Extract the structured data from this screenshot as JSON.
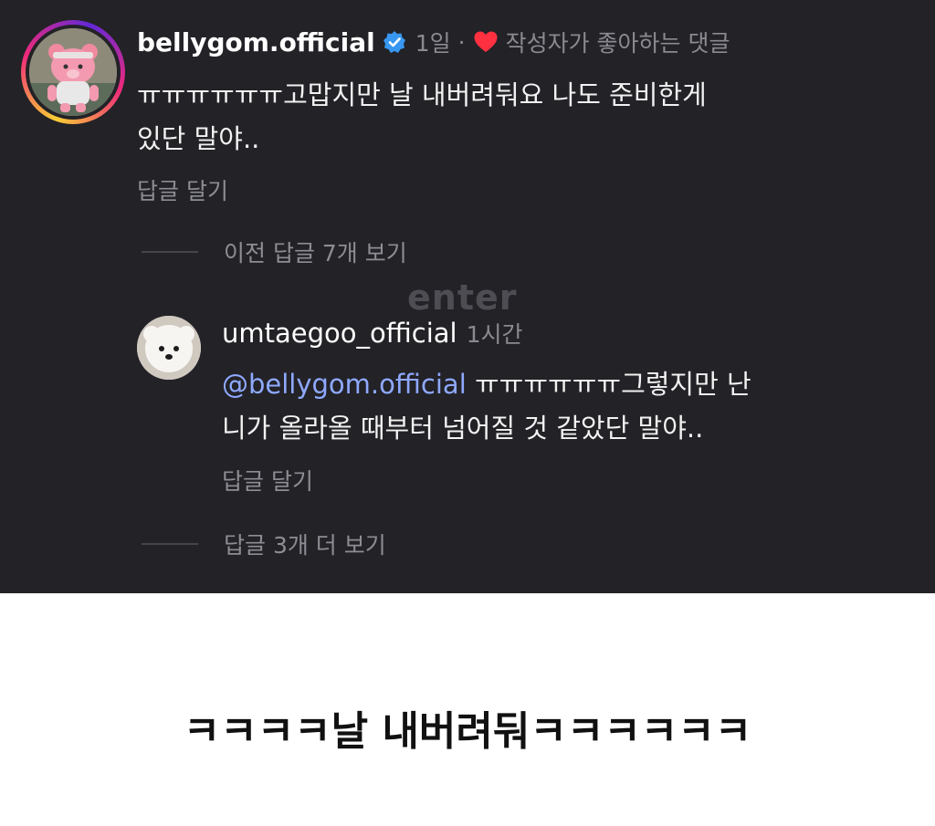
{
  "post": {
    "comment1": {
      "username": "bellygom.official",
      "verified_icon": "verified-badge-icon",
      "time": "1일",
      "separator": "·",
      "liked_icon": "heart-icon",
      "liked_text": "작성자가 좋아하는 댓글",
      "text_line1": "ㅠㅠㅠㅠㅠㅠ고맙지만 날 내버려둬요 나도 준비한게",
      "text_line2": "있단 말야..",
      "reply_label": "답글 달기",
      "view_prev_replies": "이전 답글 7개 보기"
    },
    "comment2": {
      "username": "umtaegoo_official",
      "time": "1시간",
      "mention": "@bellygom.official",
      "text_line1_rest": "ㅠㅠㅠㅠㅠㅠ그렇지만 난",
      "text_line2": "니가 올라올 때부터 넘어질 것 같았단 말야..",
      "reply_label": "답글 달기",
      "view_more_replies": "답글 3개 더 보기"
    },
    "watermark": "enter"
  },
  "caption": "ㅋㅋㅋㅋ날 내버려둬ㅋㅋㅋㅋㅋㅋ",
  "colors": {
    "background_dark": "#222227",
    "verified_blue": "#3897f0",
    "heart_red": "#ff3040",
    "mention_blue": "#8fa9ff",
    "muted_text": "#8d8d94"
  }
}
